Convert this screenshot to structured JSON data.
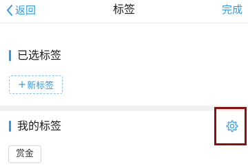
{
  "navbar": {
    "back_label": "返回",
    "title": "标签",
    "done_label": "完成"
  },
  "selected_section": {
    "title": "已选标签",
    "new_tag_label": "新标签",
    "new_tag_prefix": "+"
  },
  "my_section": {
    "title": "我的标签",
    "tags": [
      "赏金"
    ]
  },
  "icons": {
    "back": "chevron-left-icon",
    "settings": "gear-icon"
  },
  "colors": {
    "accent": "#2f9be6",
    "highlight": "#8c0f0f",
    "divider": "#f2f2f2"
  }
}
